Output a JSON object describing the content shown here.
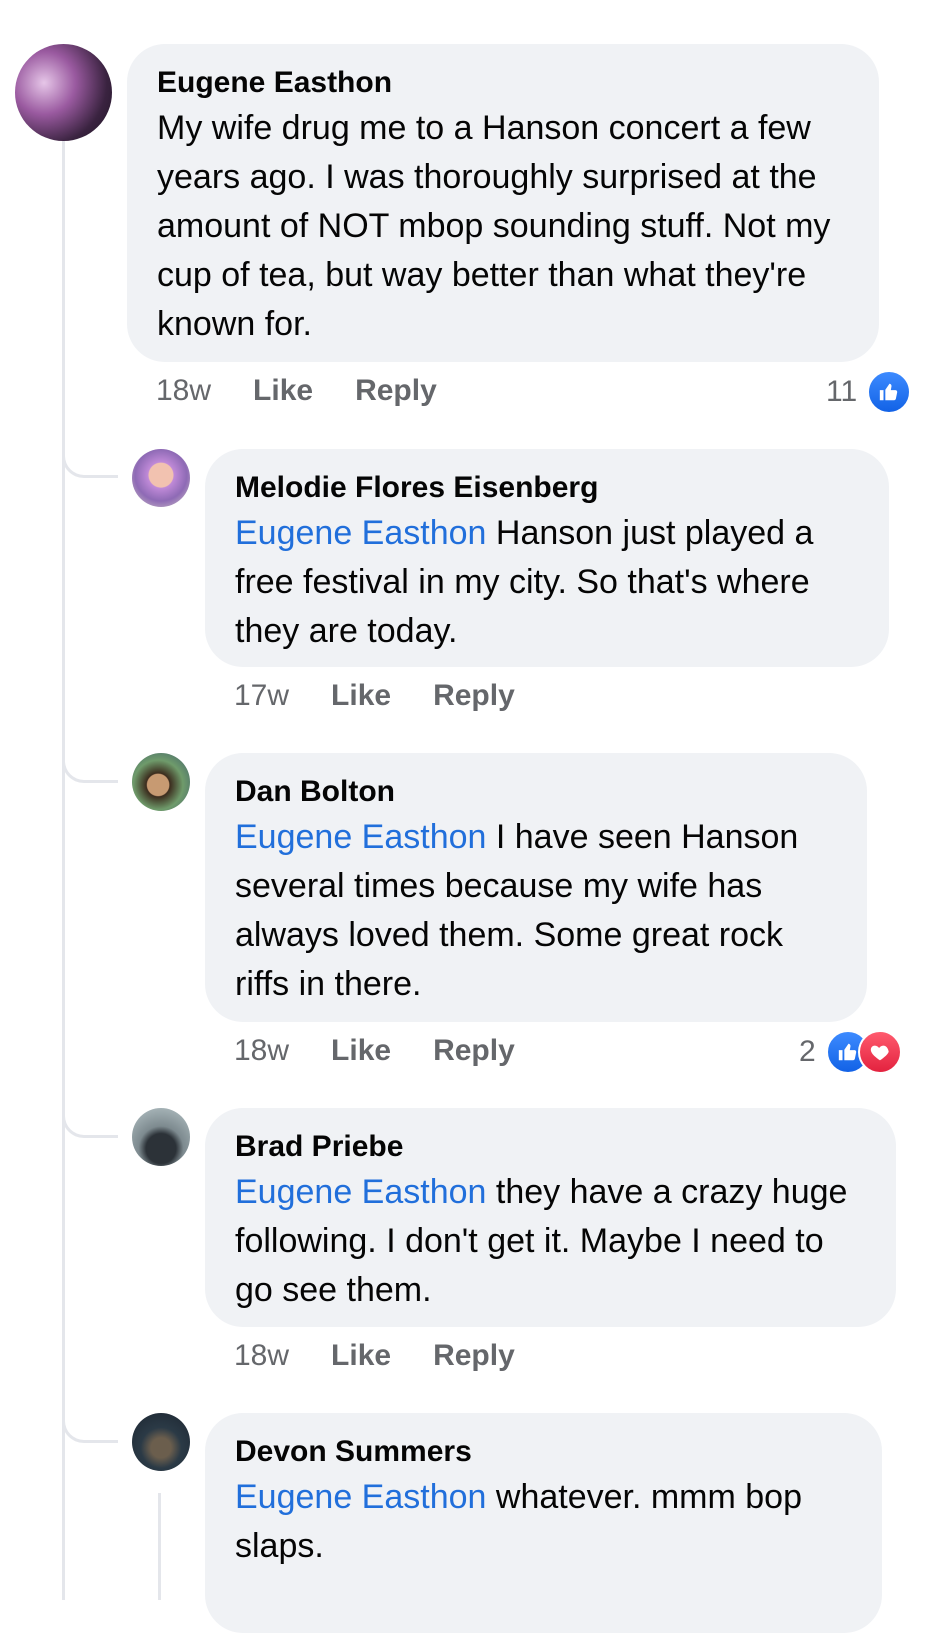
{
  "comments": [
    {
      "author": "Eugene Easthon",
      "text": "My wife drug me to a Hanson concert a few years ago. I was thoroughly surprised at the amount of NOT mbop sounding stuff. Not my cup of tea, but way better than what they're known for.",
      "time": "18w",
      "reactions_count": "11",
      "reactions": [
        "like-icon"
      ]
    },
    {
      "author": "Melodie Flores Eisenberg",
      "mention": "Eugene Easthon",
      "text": " Hanson just played a free festival in my city.  So that's where they are today.",
      "time": "17w"
    },
    {
      "author": "Dan Bolton",
      "mention": "Eugene Easthon",
      "text": " I have seen Hanson several times because my wife has always loved them. Some great rock riffs in there.",
      "time": "18w",
      "reactions_count": "2",
      "reactions": [
        "like-icon",
        "love-icon"
      ]
    },
    {
      "author": "Brad Priebe",
      "mention": "Eugene Easthon",
      "text": " they have a crazy huge following.  I don't get it.  Maybe I need to go see them.",
      "time": "18w"
    },
    {
      "author": "Devon Summers",
      "mention": "Eugene Easthon",
      "text": " whatever. mmm bop slaps."
    }
  ],
  "labels": {
    "like": "Like",
    "reply": "Reply"
  },
  "colors": {
    "bubble": "#f0f2f5",
    "mention": "#216fdb",
    "like": "#1877f2",
    "love": "#e3223f"
  }
}
